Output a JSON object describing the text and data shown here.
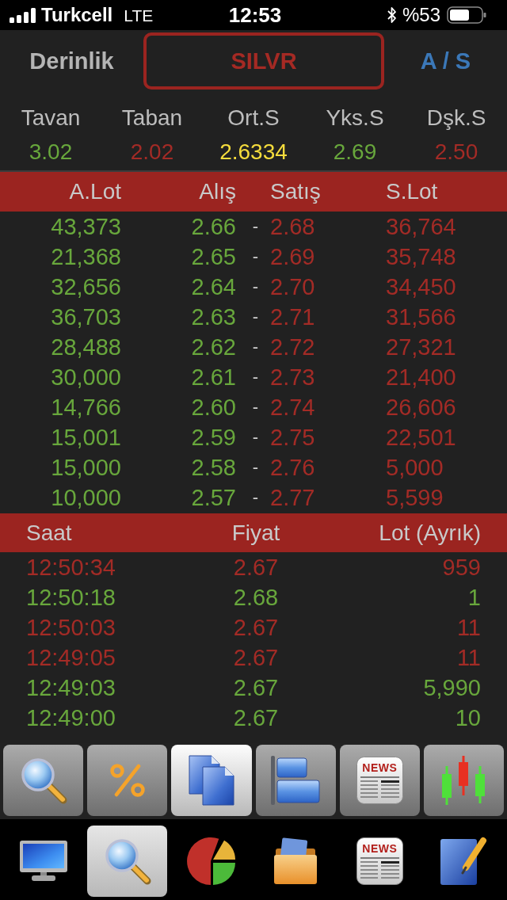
{
  "status_bar": {
    "carrier": "Turkcell",
    "network": "LTE",
    "time": "12:53",
    "battery": "%53"
  },
  "header": {
    "title": "Derinlik",
    "symbol": "SILVR",
    "toggle": "A / S"
  },
  "stats": [
    {
      "label": "Tavan",
      "value": "3.02",
      "color": "#68a73c"
    },
    {
      "label": "Taban",
      "value": "2.02",
      "color": "#a32b26"
    },
    {
      "label": "Ort.S",
      "value": "2.6334",
      "color": "#f5dc3c"
    },
    {
      "label": "Yks.S",
      "value": "2.69",
      "color": "#68a73c"
    },
    {
      "label": "Dşk.S",
      "value": "2.50",
      "color": "#a32b26"
    }
  ],
  "depth": {
    "columns": [
      "A.Lot",
      "Alış",
      "Satış",
      "S.Lot"
    ],
    "rows": [
      {
        "bid_lot": "43,373",
        "bid": "2.66",
        "separator": "-",
        "ask": "2.68",
        "ask_lot": "36,764"
      },
      {
        "bid_lot": "21,368",
        "bid": "2.65",
        "separator": "-",
        "ask": "2.69",
        "ask_lot": "35,748"
      },
      {
        "bid_lot": "32,656",
        "bid": "2.64",
        "separator": "-",
        "ask": "2.70",
        "ask_lot": "34,450"
      },
      {
        "bid_lot": "36,703",
        "bid": "2.63",
        "separator": "-",
        "ask": "2.71",
        "ask_lot": "31,566"
      },
      {
        "bid_lot": "28,488",
        "bid": "2.62",
        "separator": "-",
        "ask": "2.72",
        "ask_lot": "27,321"
      },
      {
        "bid_lot": "30,000",
        "bid": "2.61",
        "separator": "-",
        "ask": "2.73",
        "ask_lot": "21,400"
      },
      {
        "bid_lot": "14,766",
        "bid": "2.60",
        "separator": "-",
        "ask": "2.74",
        "ask_lot": "26,606"
      },
      {
        "bid_lot": "15,001",
        "bid": "2.59",
        "separator": "-",
        "ask": "2.75",
        "ask_lot": "22,501"
      },
      {
        "bid_lot": "15,000",
        "bid": "2.58",
        "separator": "-",
        "ask": "2.76",
        "ask_lot": "5,000"
      },
      {
        "bid_lot": "10,000",
        "bid": "2.57",
        "separator": "-",
        "ask": "2.77",
        "ask_lot": "5,599"
      }
    ]
  },
  "trades": {
    "columns": [
      "Saat",
      "Fiyat",
      "Lot (Ayrık)"
    ],
    "rows": [
      {
        "time": "12:50:34",
        "price": "2.67",
        "lot": "959",
        "color": "#a32b26"
      },
      {
        "time": "12:50:18",
        "price": "2.68",
        "lot": "1",
        "color": "#68a73c"
      },
      {
        "time": "12:50:03",
        "price": "2.67",
        "lot": "11",
        "color": "#a32b26"
      },
      {
        "time": "12:49:05",
        "price": "2.67",
        "lot": "11",
        "color": "#a32b26"
      },
      {
        "time": "12:49:03",
        "price": "2.67",
        "lot": "5,990",
        "color": "#68a73c"
      },
      {
        "time": "12:49:00",
        "price": "2.67",
        "lot": "10",
        "color": "#68a73c"
      }
    ]
  },
  "toolbar": [
    {
      "kind": "search",
      "selected": false
    },
    {
      "kind": "percent",
      "selected": false
    },
    {
      "kind": "documents",
      "selected": true
    },
    {
      "kind": "align",
      "selected": false
    },
    {
      "kind": "news",
      "label": "NEWS",
      "selected": false
    },
    {
      "kind": "candles",
      "selected": false
    }
  ],
  "tabs": [
    {
      "kind": "monitor",
      "selected": false
    },
    {
      "kind": "search",
      "selected": true
    },
    {
      "kind": "pie",
      "selected": false
    },
    {
      "kind": "folder",
      "selected": false
    },
    {
      "kind": "news",
      "label": "NEWS",
      "selected": false
    },
    {
      "kind": "edit",
      "selected": false
    }
  ]
}
